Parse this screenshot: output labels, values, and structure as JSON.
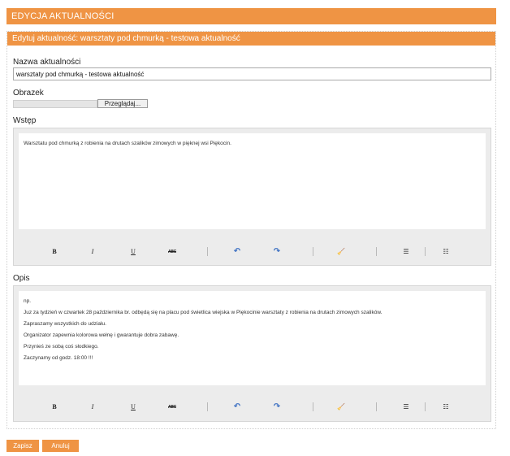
{
  "page": {
    "title": "EDYCJA AKTUALNOŚCI"
  },
  "panel": {
    "title": "Edytuj aktualność: warsztaty pod chmurką - testowa aktualność"
  },
  "fields": {
    "name_label": "Nazwa aktualności",
    "name_value": "warsztaty pod chmurką - testowa aktualność",
    "image_label": "Obrazek",
    "browse_label": "Przeglądaj...",
    "intro_label": "Wstęp",
    "intro_text": "Warsztatu pod chmurką z robienia na drutach szalików zimowych w pięknej wsi Piękocin.",
    "desc_label": "Opis",
    "desc_lines": [
      "np.",
      "Juz za tydzień w czwartek 28 października br. odbędą się na placu pod świetlica wiejska w Piękocinie warsztaty z robienia na drutach zimowych szalików.",
      "Zapraszamy wszystkich do udziału.",
      "Organizator zapewnia kolorowa wełnę i gwarantuje dobra zabawę.",
      "Przynieś ze sobą coś słodkiego.",
      "Zaczynamy od godz. 18:00 !!!"
    ]
  },
  "toolbar": {
    "bold": "B",
    "italic": "I",
    "underline": "U",
    "strike": "ABC",
    "undo": "↶",
    "redo": "↷",
    "clean": "🧹",
    "bullets": "☰",
    "numbered": "☷",
    "icons": [
      "bold-icon",
      "italic-icon",
      "underline-icon",
      "strikethrough-icon",
      "undo-icon",
      "redo-icon",
      "clear-format-icon",
      "bullet-list-icon",
      "numbered-list-icon"
    ]
  },
  "actions": {
    "save": "Zapisz",
    "cancel": "Anuluj"
  },
  "colors": {
    "accent": "#ef9444",
    "editor_bg": "#ececec"
  }
}
